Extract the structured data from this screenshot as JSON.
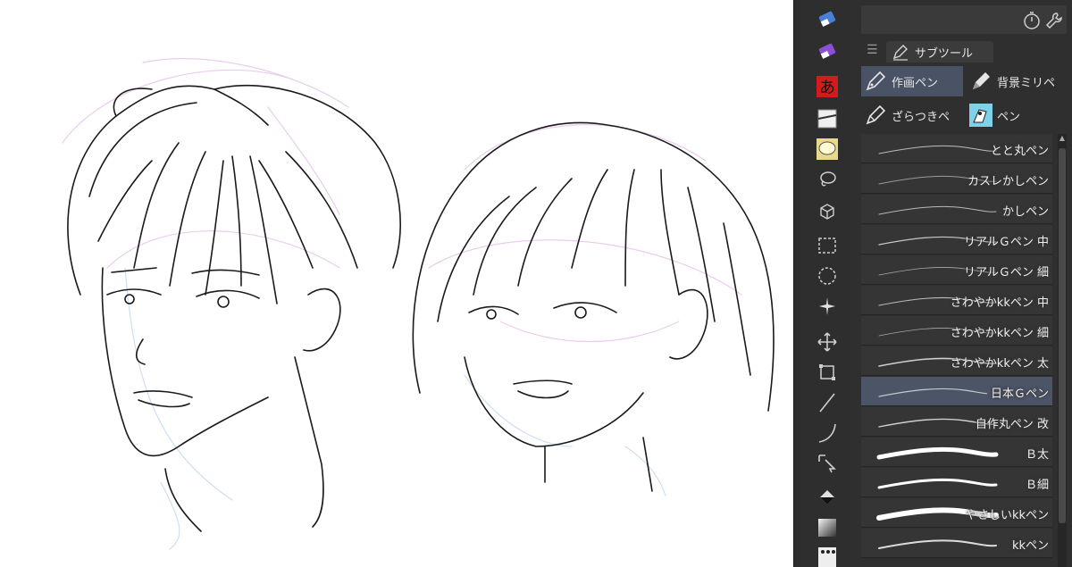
{
  "subtool_panel": {
    "title": "サブツール",
    "groups": [
      {
        "label": "作画ペン",
        "icon": "pen-nib-icon",
        "active": true
      },
      {
        "label": "背景ミリペ",
        "icon": "marker-icon",
        "active": false
      },
      {
        "label": "ざらつきペ",
        "icon": "rough-pen-icon",
        "active": false
      },
      {
        "label": "ペン",
        "icon": "custom-pen-icon",
        "active": false
      }
    ],
    "brushes": [
      {
        "label": "とと丸ペン"
      },
      {
        "label": "カスレかしペン"
      },
      {
        "label": "かしペン"
      },
      {
        "label": "リアルＧペン 中"
      },
      {
        "label": "リアルＧペン 細"
      },
      {
        "label": "さわやかkkペン 中"
      },
      {
        "label": "さわやかkkペン 細"
      },
      {
        "label": "さわやかkkペン 太"
      },
      {
        "label": "日本Ｇペン",
        "selected": true
      },
      {
        "label": "自作丸ペン 改"
      },
      {
        "label": "Ｂ太"
      },
      {
        "label": "Ｂ細"
      },
      {
        "label": "やさしいkkペン"
      },
      {
        "label": "kkペン"
      }
    ]
  },
  "toolbar": {
    "tools": [
      "eraser-blue-icon",
      "eraser-purple-icon",
      "text-tool-icon",
      "frame-border-icon",
      "speech-balloon-icon",
      "lasso-icon",
      "3d-object-icon",
      "rect-select-icon",
      "ellipse-select-icon",
      "auto-select-icon",
      "move-icon",
      "transform-icon",
      "line-icon",
      "curve-icon",
      "correct-line-icon",
      "fill-icon",
      "gradient-icon",
      "tone-icon"
    ]
  },
  "colors": {
    "accent_selected": "#4c5468",
    "panel_bg": "#2f2f2f",
    "canvas_bg": "#ffffff"
  }
}
